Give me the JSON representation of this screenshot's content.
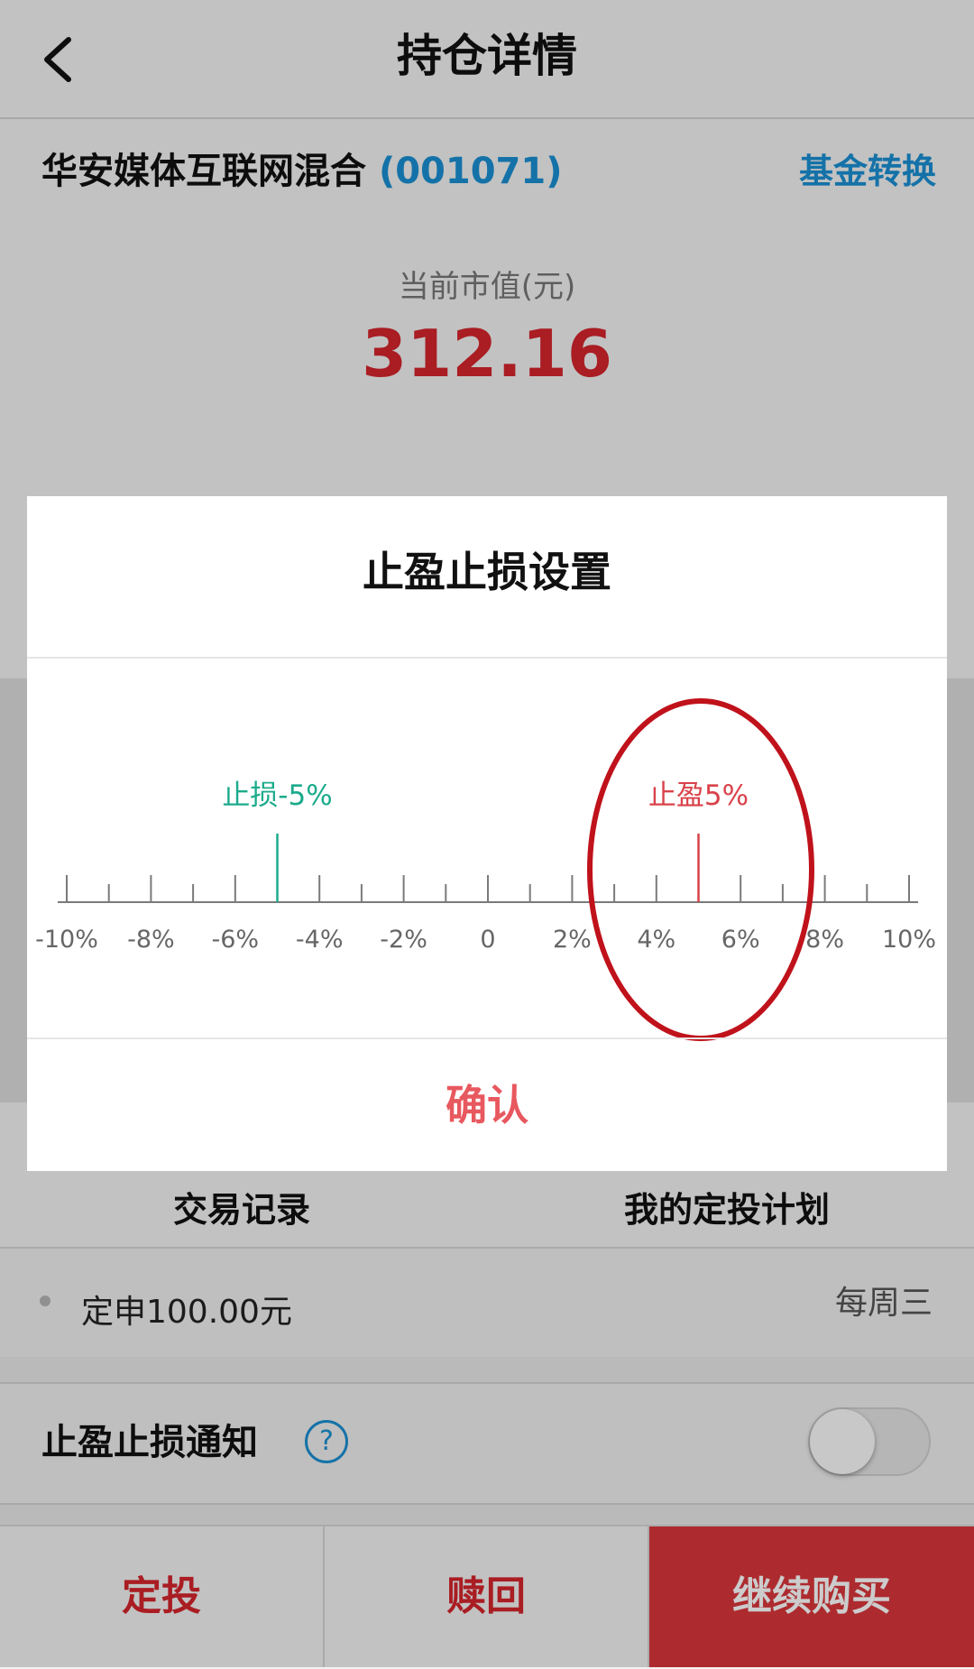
{
  "header": {
    "title": "持仓详情",
    "back_icon": "chevron-left-icon"
  },
  "fund": {
    "name": "华安媒体互联网混合",
    "code": "(001071)",
    "convert_label": "基金转换"
  },
  "market_value": {
    "label": "当前市值(元)",
    "value": "312.16"
  },
  "tabs": {
    "left": "交易记录",
    "right": "我的定投计划"
  },
  "plan": {
    "amount": "定申100.00元",
    "frequency": "每周三"
  },
  "notify": {
    "label": "止盈止损通知",
    "help": "?",
    "enabled": false
  },
  "bottom_actions": {
    "sip": "定投",
    "redeem": "赎回",
    "buy": "继续购买"
  },
  "modal": {
    "title": "止盈止损设置",
    "confirm_label": "确认",
    "scale": {
      "min": -10,
      "max": 10,
      "major_step": 2,
      "minor_step": 1,
      "tick_labels": [
        "-10%",
        "-8%",
        "-6%",
        "-4%",
        "-2%",
        "0",
        "2%",
        "4%",
        "6%",
        "8%",
        "10%"
      ],
      "stop_loss": {
        "label": "止损-5%",
        "value": -5,
        "color": "#1bab8b"
      },
      "take_profit": {
        "label": "止盈5%",
        "value": 5,
        "color": "#d9424a"
      }
    }
  },
  "colors": {
    "accent_blue": "#1a8fd2",
    "accent_red": "#d4252c",
    "highlight_circle": "#c0121b"
  }
}
